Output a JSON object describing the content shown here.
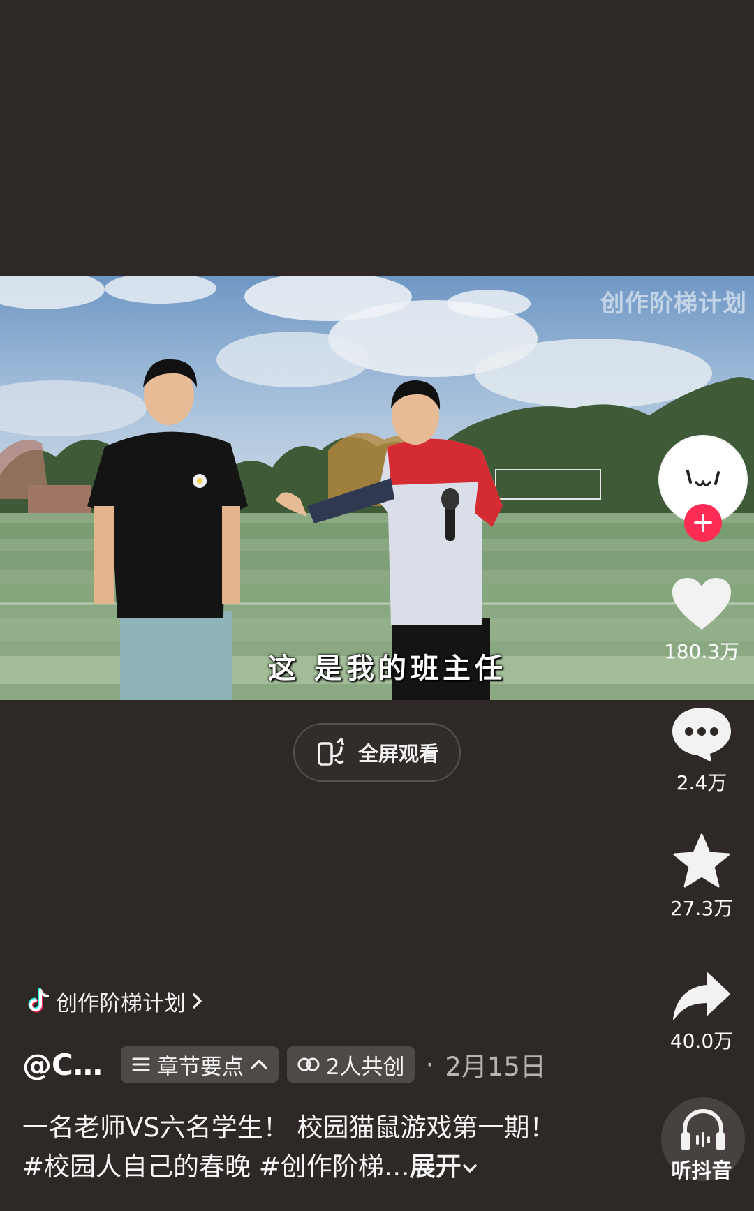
{
  "video": {
    "watermark": "创作阶梯计划",
    "subtitle": "这 是我的班主任"
  },
  "fullscreen": {
    "label": "全屏观看",
    "icon": "rotate-phone-icon"
  },
  "rail": {
    "avatar": {
      "icon": "smiley-face-avatar"
    },
    "follow": {
      "icon": "plus-icon",
      "color": "#fe2c55"
    },
    "like": {
      "count": "180.3万",
      "icon": "heart-icon"
    },
    "comment": {
      "count": "2.4万",
      "icon": "comment-bubble-icon"
    },
    "favorite": {
      "count": "27.3万",
      "icon": "star-icon"
    },
    "share": {
      "count": "40.0万",
      "icon": "share-arrow-icon"
    },
    "listen": {
      "label": "听抖音",
      "icon": "headphones-icon"
    }
  },
  "tag": {
    "label": "创作阶梯计划",
    "icon": "douyin-note-icon"
  },
  "meta": {
    "author": "@C…",
    "chapter_label": "章节要点",
    "cocreate_label": "2人共创",
    "date_sep": "·",
    "date": "2月15日"
  },
  "description": {
    "text": "一名老师VS六名学生！ 校园猫鼠游戏第一期！#校园人自己的春晚 #创作阶梯…",
    "expand": "展开"
  }
}
